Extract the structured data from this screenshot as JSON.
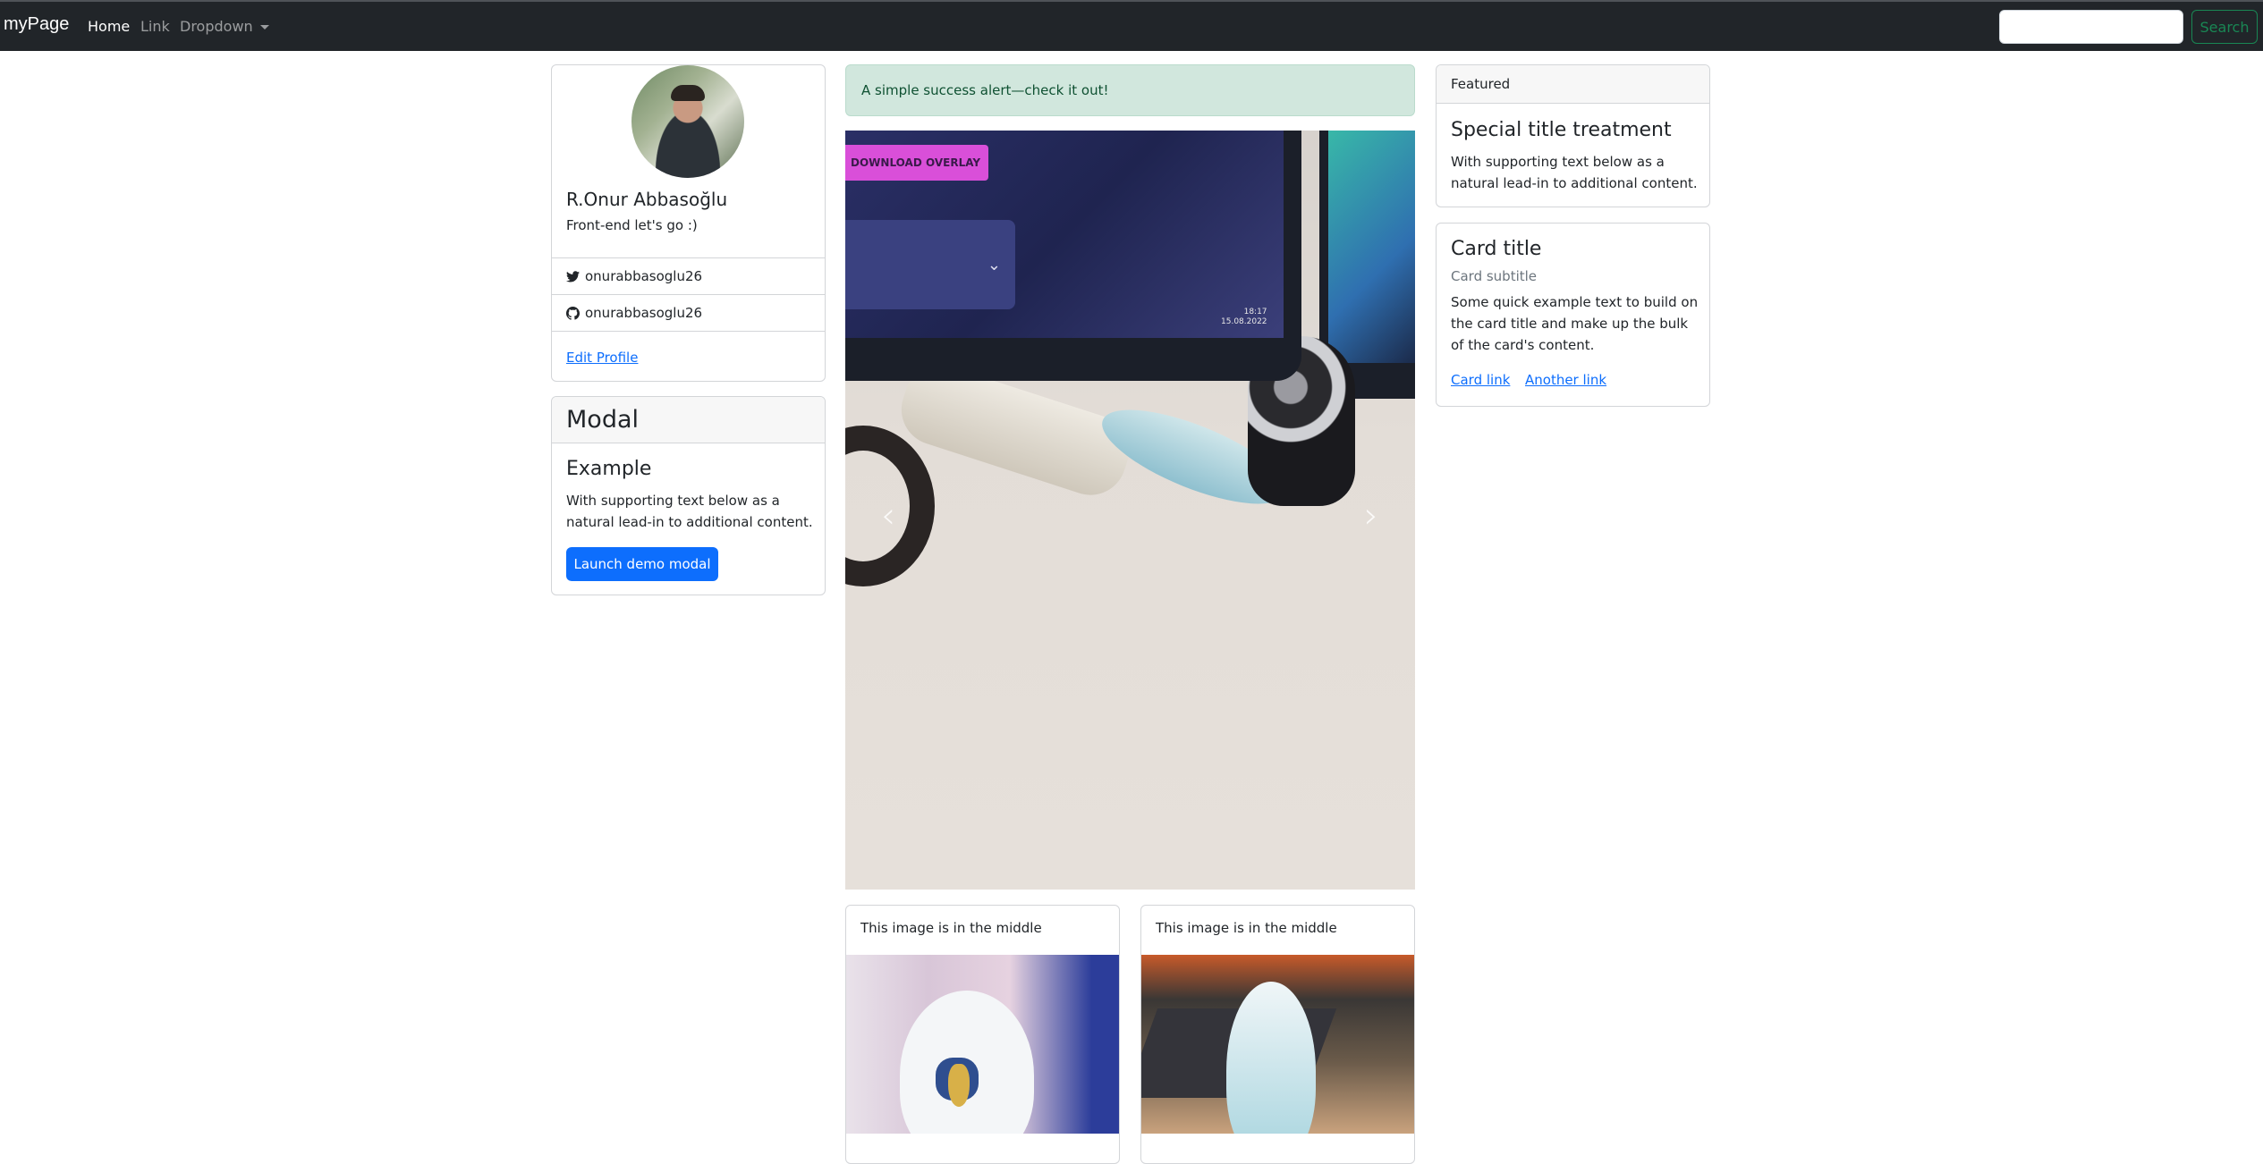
{
  "navbar": {
    "brand": "myPage",
    "links": [
      "Home",
      "Link",
      "Dropdown"
    ],
    "search_button": "Search"
  },
  "profile": {
    "name": "R.Onur Abbasoğlu",
    "subtitle": "Front-end let's go :)",
    "twitter": "onurabbasoglu26",
    "github": "onurabbasoglu26",
    "edit_link": "Edit Profile"
  },
  "modal_card": {
    "header": "Modal",
    "title": "Example",
    "text": "With supporting text below as a natural lead-in to additional content.",
    "button": "Launch demo modal"
  },
  "alert": {
    "text": "A simple success alert—check it out!"
  },
  "carousel": {
    "screen_button": "DOWNLOAD OVERLAY",
    "time": "18:17",
    "date": "15.08.2022",
    "prev_icon": "chevron-left-icon",
    "next_icon": "chevron-right-icon"
  },
  "image_cards": [
    {
      "header": "This image is in the middle"
    },
    {
      "header": "This image is in the middle"
    }
  ],
  "featured_card": {
    "header": "Featured",
    "title": "Special title treatment",
    "text": "With supporting text below as a natural lead-in to additional content."
  },
  "title_card": {
    "title": "Card title",
    "subtitle": "Card subtitle",
    "text": "Some quick example text to build on the card title and make up the bulk of the card's content.",
    "link1": "Card link",
    "link2": "Another link"
  },
  "colors": {
    "navbar_bg": "#212529",
    "primary": "#0d6efd",
    "success": "#198754",
    "alert_bg": "#d1e7dd"
  }
}
